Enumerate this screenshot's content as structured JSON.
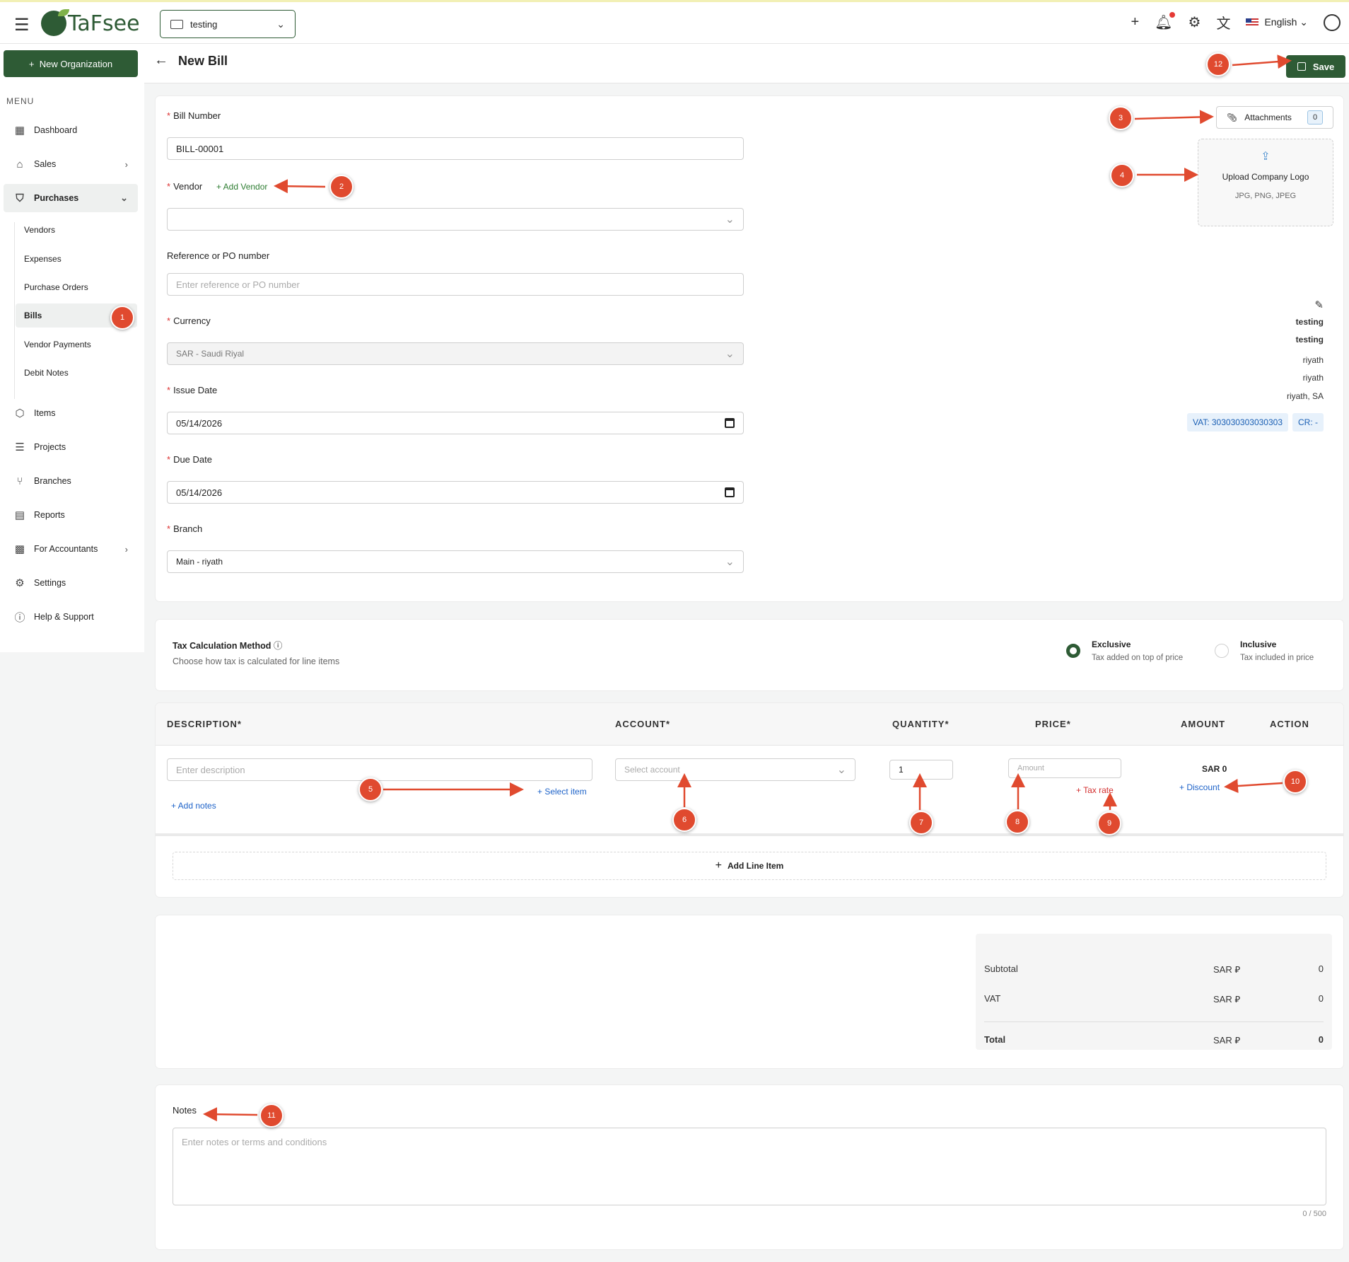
{
  "app": {
    "brand": "TaFsee",
    "org": "testing",
    "language": "English",
    "accent": "#2e5b35"
  },
  "sidebar": {
    "new_org": "New Organization",
    "menu_title": "MENU",
    "items": [
      {
        "label": "Dashboard"
      },
      {
        "label": "Sales"
      },
      {
        "label": "Purchases"
      },
      {
        "label": "Items"
      },
      {
        "label": "Projects"
      },
      {
        "label": "Branches"
      },
      {
        "label": "Reports"
      },
      {
        "label": "For Accountants"
      },
      {
        "label": "Settings"
      },
      {
        "label": "Help & Support"
      }
    ],
    "sub_items": [
      {
        "label": "Vendors"
      },
      {
        "label": "Expenses"
      },
      {
        "label": "Purchase Orders"
      },
      {
        "label": "Bills"
      },
      {
        "label": "Vendor Payments"
      },
      {
        "label": "Debit Notes"
      }
    ]
  },
  "header": {
    "title": "New Bill",
    "save": "Save"
  },
  "form": {
    "bill_number_label": "Bill Number",
    "bill_number": "BILL-00001",
    "vendor_label": "Vendor",
    "add_vendor": "+ Add Vendor",
    "reference_label": "Reference or PO number",
    "reference_placeholder": "Enter reference or PO number",
    "currency_label": "Currency",
    "currency": "SAR - Saudi Riyal",
    "issue_date_label": "Issue Date",
    "issue_date": "05/14/2026",
    "due_date_label": "Due Date",
    "due_date": "05/14/2026",
    "branch_label": "Branch",
    "branch": "Main - riyath"
  },
  "company": {
    "attachments": "Attachments",
    "attachments_count": "0",
    "upload_title": "Upload Company Logo",
    "upload_formats": "JPG, PNG, JPEG",
    "lines": [
      "testing",
      "testing",
      "riyath",
      "riyath",
      "riyath, SA"
    ],
    "vat": "VAT: 303030303030303",
    "cr": "CR: -"
  },
  "tax": {
    "title": "Tax Calculation Method",
    "subtitle": "Choose how tax is calculated for line items",
    "exclusive_title": "Exclusive",
    "exclusive_sub": "Tax added on top of price",
    "inclusive_title": "Inclusive",
    "inclusive_sub": "Tax included in price",
    "selected": "Exclusive"
  },
  "lines": {
    "headers": {
      "description": "DESCRIPTION*",
      "account": "ACCOUNT*",
      "quantity": "QUANTITY*",
      "price": "PRICE*",
      "amount": "AMOUNT",
      "action": "ACTION"
    },
    "description_placeholder": "Enter description",
    "select_item": "+ Select item",
    "add_notes": "+ Add notes",
    "account_placeholder": "Select account",
    "quantity": "1",
    "price_placeholder": "Amount",
    "tax_rate": "+ Tax rate",
    "amount": "SAR 0",
    "discount": "+ Discount",
    "add_line": "Add Line Item"
  },
  "totals": {
    "subtotal_label": "Subtotal",
    "subtotal_currency": "SAR ⃁",
    "subtotal": "0",
    "vat_label": "VAT",
    "vat_currency": "SAR ⃁",
    "vat": "0",
    "total_label": "Total",
    "total_currency": "SAR ⃁",
    "total": "0"
  },
  "notes": {
    "label": "Notes",
    "placeholder": "Enter notes or terms and conditions",
    "count": "0 / 500"
  },
  "annotations": [
    "1",
    "2",
    "3",
    "4",
    "5",
    "6",
    "7",
    "8",
    "9",
    "10",
    "11",
    "12"
  ]
}
